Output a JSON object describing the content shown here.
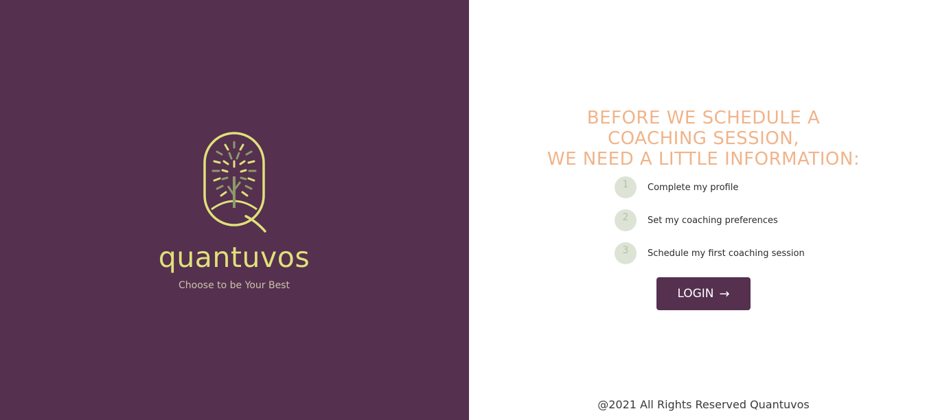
{
  "brand": {
    "name": "quantuvos",
    "tagline": "Choose to be Your Best",
    "logo_icon": "tree-in-arch-logo-icon"
  },
  "heading": {
    "line1": "BEFORE WE SCHEDULE A",
    "line2": "COACHING SESSION,",
    "line3": "WE NEED A LITTLE INFORMATION:"
  },
  "steps": [
    {
      "number": "1",
      "label": "Complete my profile"
    },
    {
      "number": "2",
      "label": "Set my coaching preferences"
    },
    {
      "number": "3",
      "label": "Schedule my first coaching session"
    }
  ],
  "login": {
    "label": "LOGIN",
    "icon": "arrow-right-icon",
    "arrow": "→"
  },
  "footer": {
    "text": "@2021 All Rights Reserved Quantuvos"
  },
  "colors": {
    "primary": "#55304f",
    "accent_heading": "#f0b48a",
    "logo_yellow": "#dfe07a",
    "step_circle": "#dde3d5"
  }
}
